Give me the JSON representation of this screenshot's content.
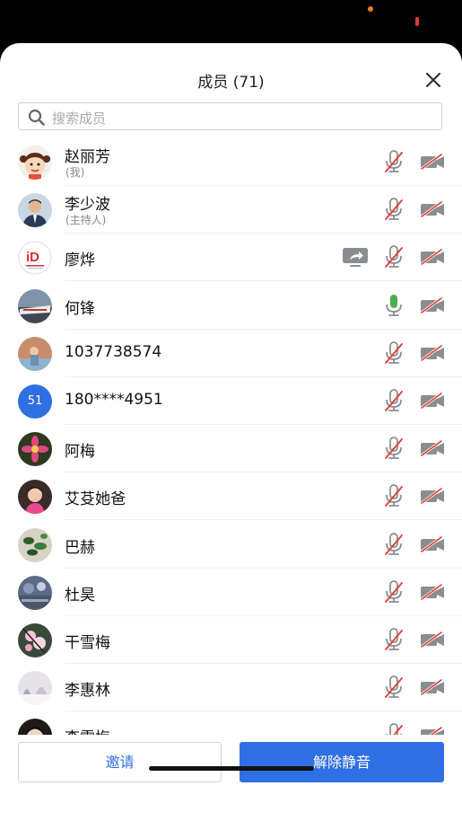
{
  "header": {
    "title": "成员 (71)"
  },
  "search": {
    "placeholder": "搜索成员"
  },
  "members": [
    {
      "name": "赵丽芳",
      "sub": "(我)",
      "avatar": "cartoon-girl-avatar",
      "mic": "muted",
      "cam": "off"
    },
    {
      "name": "李少波",
      "sub": "(主持人)",
      "avatar": "man-portrait-avatar",
      "mic": "muted",
      "cam": "off"
    },
    {
      "name": "廖烨",
      "sub": "",
      "avatar": "id-logo-avatar",
      "mic": "muted",
      "cam": "off",
      "sharing": true
    },
    {
      "name": "何锋",
      "sub": "",
      "avatar": "train-photo-avatar",
      "mic": "active",
      "cam": "off"
    },
    {
      "name": "1037738574",
      "sub": "",
      "avatar": "outdoor-photo-avatar",
      "mic": "muted",
      "cam": "off"
    },
    {
      "name": "180****4951",
      "sub": "",
      "avatar": "number-avatar",
      "avatar_text": "51",
      "mic": "muted",
      "cam": "off"
    },
    {
      "name": "阿梅",
      "sub": "",
      "avatar": "flower-photo-avatar",
      "mic": "muted",
      "cam": "off"
    },
    {
      "name": "艾芟她爸",
      "sub": "",
      "avatar": "child-photo-avatar",
      "mic": "muted",
      "cam": "off"
    },
    {
      "name": "巴赫",
      "sub": "",
      "avatar": "plant-photo-avatar",
      "mic": "muted",
      "cam": "off"
    },
    {
      "name": "杜昊",
      "sub": "",
      "avatar": "landscape-photo-avatar",
      "mic": "muted",
      "cam": "off"
    },
    {
      "name": "干雪梅",
      "sub": "",
      "avatar": "blossom-photo-avatar",
      "mic": "muted",
      "cam": "off"
    },
    {
      "name": "李惠林",
      "sub": "",
      "avatar": "snow-photo-avatar",
      "mic": "muted",
      "cam": "off"
    },
    {
      "name": "李雪梅",
      "sub": "",
      "avatar": "portrait-photo-avatar",
      "mic": "muted",
      "cam": "off"
    }
  ],
  "footer": {
    "invite_label": "邀请",
    "unmute_all_label": "解除静音"
  },
  "colors": {
    "accent": "#2f6fe4",
    "mic_active": "#4caf50",
    "muted_slash": "#e53935",
    "icon_gray": "#8a8d92"
  }
}
